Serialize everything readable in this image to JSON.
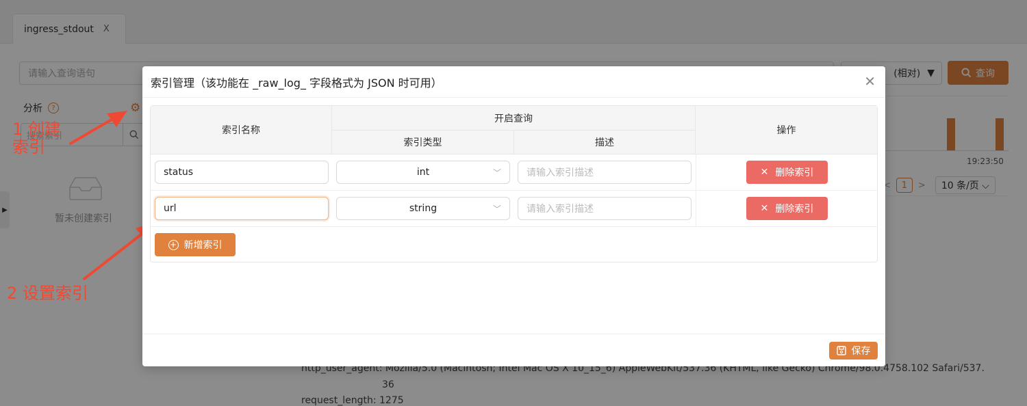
{
  "tabs": [
    {
      "label": "ingress_stdout",
      "close_glyph": "X"
    }
  ],
  "search": {
    "placeholder": "请输入查询语句"
  },
  "time_range": {
    "label": "(相对)"
  },
  "query_button": {
    "label": "查询"
  },
  "sidebar": {
    "title": "分析",
    "search_placeholder": "搜索索引",
    "empty_text": "暂未创建索引"
  },
  "histogram": {
    "axis_label": "19:23:50"
  },
  "pagination": {
    "current_page": "1",
    "page_size": "10 条/页"
  },
  "log_lines": {
    "line1": "http_user_agent: Mozilla/5.0 (Macintosh; Intel Mac OS X 10_15_6) AppleWebKit/537.36 (KHTML, like Gecko) Chrome/98.0.4758.102 Safari/537.",
    "line1_cont": "36",
    "line2": "request_length: 1275"
  },
  "annotations": {
    "step1": "1 创建\n索引",
    "step2": "2 设置索引"
  },
  "modal": {
    "title": "索引管理（该功能在 _raw_log_ 字段格式为 JSON 时可用）",
    "headers": {
      "name": "索引名称",
      "query_group": "开启查询",
      "type": "索引类型",
      "description": "描述",
      "actions": "操作"
    },
    "rows": [
      {
        "name": "status",
        "type": "int",
        "desc_placeholder": "请输入索引描述",
        "delete_label": "删除索引"
      },
      {
        "name": "url",
        "type": "string",
        "desc_placeholder": "请输入索引描述",
        "delete_label": "删除索引"
      }
    ],
    "add_label": "新增索引",
    "save_label": "保存"
  },
  "colors": {
    "accent": "#e0823e",
    "danger": "#ec6a64",
    "annotation": "#ee4a33"
  }
}
